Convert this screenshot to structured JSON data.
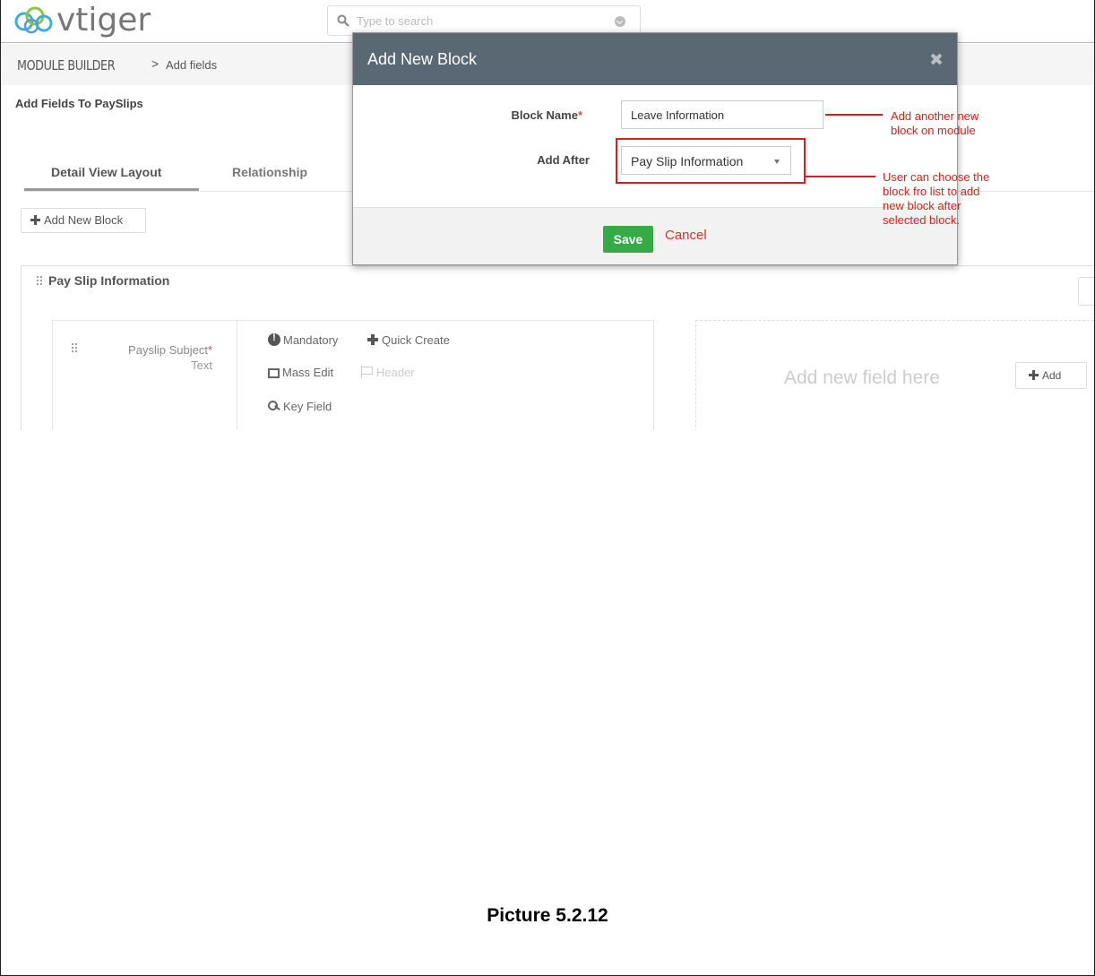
{
  "header": {
    "logo_text": "vtiger",
    "search_placeholder": "Type to search"
  },
  "breadcrumb": {
    "module": "MODULE BUILDER",
    "separator": ">",
    "current": "Add fields"
  },
  "page_title": "Add Fields To PaySlips",
  "tabs": [
    {
      "label": "Detail View Layout",
      "active": true
    },
    {
      "label": "Relationship",
      "active": false
    }
  ],
  "add_new_block_label": "Add New Block",
  "block": {
    "title": "Pay Slip Information",
    "field": {
      "name": "Payslip Subject",
      "required_mark": "*",
      "type": "Text",
      "options": {
        "mandatory": "Mandatory",
        "quick_create": "Quick Create",
        "mass_edit": "Mass Edit",
        "header": "Header",
        "key_field": "Key Field"
      }
    },
    "add_field_text": "Add new field here",
    "add_button_label": "Add"
  },
  "modal": {
    "title": "Add New Block",
    "block_name_label": "Block Name",
    "required_mark": "*",
    "block_name_value": "Leave Information",
    "add_after_label": "Add After",
    "add_after_selected": "Pay Slip Information",
    "save_label": "Save",
    "cancel_label": "Cancel"
  },
  "annotations": {
    "block_name_note_1": "Add another new",
    "block_name_note_2": "block on module",
    "add_after_note_1": "User can choose the",
    "add_after_note_2": "block fro list to add",
    "add_after_note_3": "new block after",
    "add_after_note_4": "selected block.",
    "color": "#e01b1b"
  },
  "caption": "Picture 5.2.12",
  "colors": {
    "modal_header": "#5a6873",
    "save_button": "#35aa47",
    "cancel_text": "#d9302a",
    "header_border": "#c9a8e0"
  }
}
